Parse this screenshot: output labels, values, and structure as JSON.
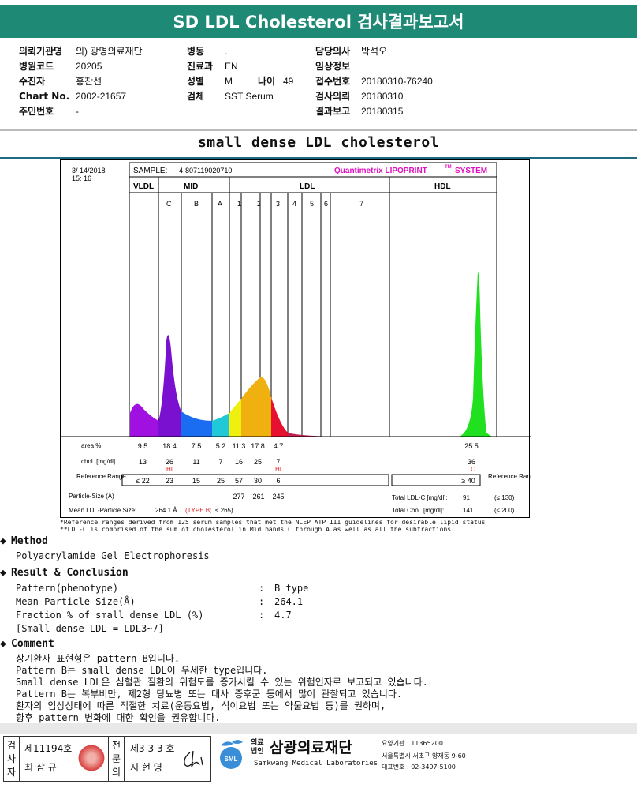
{
  "header": {
    "title": "SD LDL Cholesterol 검사결과보고서"
  },
  "patient": {
    "col1": [
      {
        "label": "의뢰기관명",
        "value": "의) 광명의료재단"
      },
      {
        "label": "병원코드",
        "value": "20205"
      },
      {
        "label": "수진자",
        "value": "홍찬선"
      },
      {
        "label": "Chart No.",
        "value": "2002-21657"
      },
      {
        "label": "주민번호",
        "value": "-"
      }
    ],
    "col2": [
      {
        "label": "병동",
        "value": "."
      },
      {
        "label": "진료과",
        "value": "EN"
      },
      {
        "label": "성별",
        "value": "M"
      },
      {
        "label": "검체",
        "value": "SST Serum"
      }
    ],
    "age_label": "나이",
    "age_value": "49",
    "col3": [
      {
        "label": "담당의사",
        "value": "박석오"
      },
      {
        "label": "임상정보",
        "value": ""
      },
      {
        "label": "접수번호",
        "value": "20180310-76240"
      },
      {
        "label": "검사의뢰",
        "value": "20180310"
      },
      {
        "label": "결과보고",
        "value": "20180315"
      }
    ]
  },
  "report": {
    "subtitle": "small dense LDL cholesterol",
    "date": "3/ 14/2018",
    "time": "15: 16",
    "sample_label": "SAMPLE:",
    "sample_id": "4-807119020710",
    "brand": "Quantimetrix LIPOPRINT",
    "brand_tm": "TM",
    "brand_system": "SYSTEM",
    "band_groups": [
      "VLDL",
      "MID",
      "LDL",
      "HDL"
    ],
    "mid_bands": [
      "C",
      "B",
      "A"
    ],
    "ldl_bands": [
      "1",
      "2",
      "3",
      "4",
      "5",
      "6",
      "7"
    ],
    "row_labels": {
      "area": "area %",
      "chol": "chol. [mg/dl]",
      "ref": "Reference Range",
      "size": "Particle-Size (Å)",
      "mean": "Mean LDL-Particle Size:"
    },
    "area": [
      "9.5",
      "18.4",
      "7.5",
      "5.2",
      "11.3",
      "17.8",
      "4.7",
      "25.5"
    ],
    "chol": [
      "13",
      "26",
      "11",
      "7",
      "16",
      "25",
      "7",
      "36"
    ],
    "flags": {
      "c": "HI",
      "ldl3": "HI",
      "hdl": "LO"
    },
    "ref": [
      "≤ 22",
      "23",
      "15",
      "25",
      "57",
      "30",
      "6",
      "≥ 40"
    ],
    "ref_right_label": "Reference Range",
    "sizes": [
      "277",
      "261",
      "245"
    ],
    "mean_size": "264.1 Å",
    "mean_type": "(TYPE B;",
    "mean_type_cut": "≤ 265)",
    "total_ldl_label": "Total LDL-C [mg/dl]:",
    "total_ldl_value": "91",
    "total_ldl_ref": "(≤ 130)",
    "total_chol_label": "Total Chol. [mg/dl]:",
    "total_chol_value": "141",
    "total_chol_ref": "(≤ 200)",
    "footnote1": "*Reference ranges derived from 125 serum samples that met the NCEP ATP III guidelines for desirable lipid status",
    "footnote2": "**LDL-C is comprised of the sum of cholesterol in Mid bands C through A as well as all the subfractions"
  },
  "chart_data": {
    "type": "area",
    "title": "",
    "bands": [
      "VLDL",
      "C",
      "B",
      "A",
      "1",
      "2",
      "3",
      "4",
      "5",
      "6",
      "7",
      "HDL"
    ],
    "area_percent": [
      9.5,
      18.4,
      7.5,
      5.2,
      11.3,
      17.8,
      4.7,
      null,
      null,
      null,
      null,
      25.5
    ],
    "cholesterol_mg_dl": [
      13,
      26,
      11,
      7,
      16,
      25,
      7,
      null,
      null,
      null,
      null,
      36
    ],
    "colors": {
      "VLDL": "#9b10d8",
      "C": "#7a10d0",
      "B": "#1a6cf0",
      "A": "#20c8d8",
      "1": "#f0f010",
      "2": "#f0b010",
      "3": "#e81030",
      "HDL": "#20e020"
    }
  },
  "method": {
    "heading": "Method",
    "text": "Polyacrylamide Gel Electrophoresis"
  },
  "result": {
    "heading": "Result & Conclusion",
    "rows": [
      {
        "label": "Pattern(phenotype)",
        "value": "B type"
      },
      {
        "label": "Mean Particle Size(Å)",
        "value": "264.1"
      },
      {
        "label": "Fraction % of small dense LDL (%)",
        "value": "4.7"
      }
    ],
    "colon": ":",
    "note": "[Small dense LDL = LDL3~7]"
  },
  "comment": {
    "heading": "Comment",
    "lines": [
      "상기환자 표현형은 pattern B입니다.",
      "Pattern B는 small dense LDL이 우세한 type입니다.",
      "Small dense LDL은 심혈관 질환의 위험도를 증가시킬 수 있는 위험인자로 보고되고 있습니다.",
      "Pattern B는 복부비만, 제2형 당뇨병 또는 대사 증후군 등에서 많이 관찰되고 있습니다.",
      "환자의 임상상태에 따른 적절한 치료(운동요법, 식이요법 또는 약물요법 등)를 권하며,",
      "향후 pattern 변화에 대한 확인을 권유합니다."
    ]
  },
  "footer": {
    "tester_label": [
      "검",
      "사",
      "자"
    ],
    "tester_no": "제11194호",
    "tester_name": "최 삼 규",
    "doctor_label": [
      "전",
      "문",
      "의"
    ],
    "doctor_no": "제3 3 3 호",
    "doctor_name": "지 현 영",
    "org_small1": "의료",
    "org_small2": "법인",
    "org_name": "삼광의료재단",
    "org_english": "Samkwang Medical Laboratories",
    "sml": "SML",
    "code_line": "요양기관 : 11365200",
    "addr_line": "서울특별시 서초구 양재동 9-60",
    "tel_line": "대표번호 : 02-3497-5100"
  }
}
